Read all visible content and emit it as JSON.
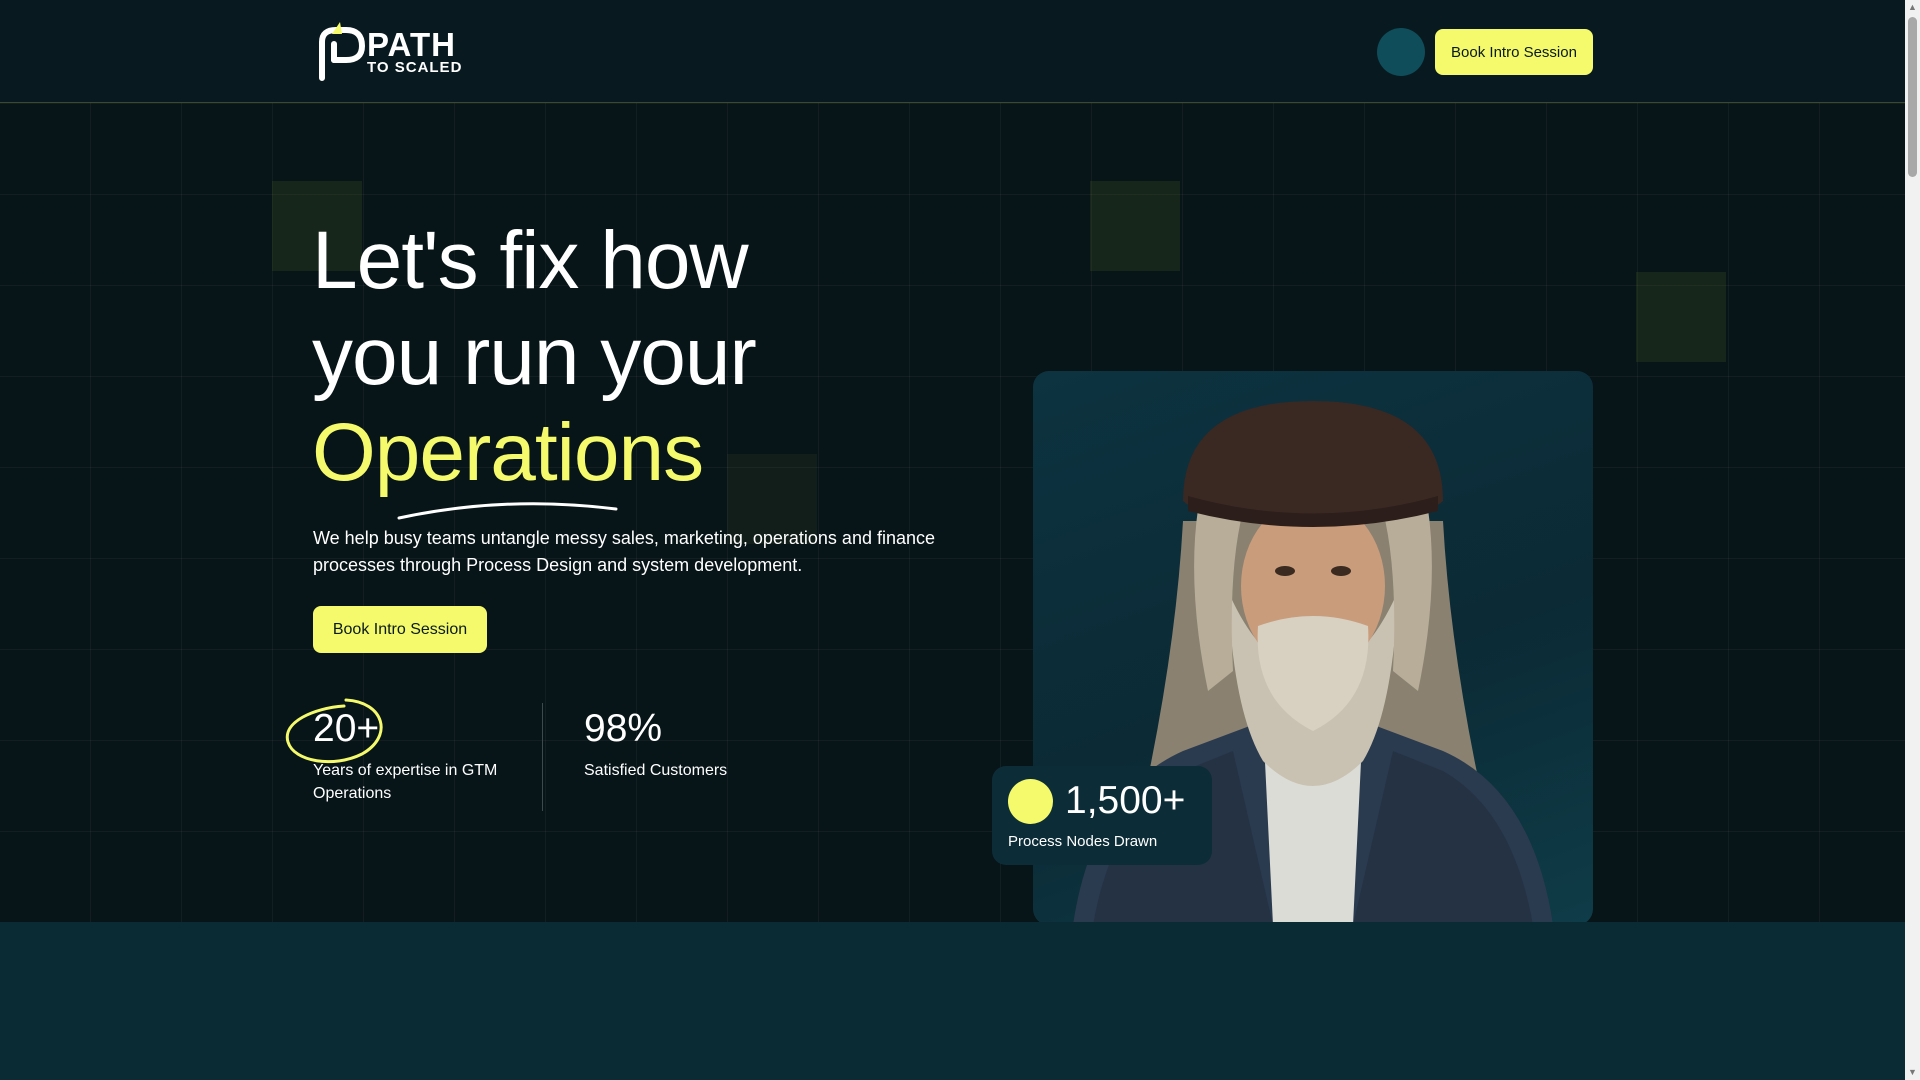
{
  "header": {
    "logo_main": "PATH",
    "logo_sub": "TO SCALED",
    "cta_label": "Book Intro Session"
  },
  "hero": {
    "headline_line1": "Let's fix how",
    "headline_line2": "you run your",
    "headline_accent": "Operations",
    "subcopy": "We help busy teams untangle messy sales, marketing, operations and finance processes through Process Design and system development.",
    "cta_label": "Book Intro Session"
  },
  "stats": [
    {
      "value": "20+",
      "label": "Years of expertise in GTM Operations"
    },
    {
      "value": "98%",
      "label": "Satisfied Customers"
    }
  ],
  "badge": {
    "value": "1,500+",
    "label": "Process Nodes Drawn"
  },
  "colors": {
    "accent": "#f4fa6b",
    "background": "#081a20",
    "card": "#0c2d37"
  }
}
